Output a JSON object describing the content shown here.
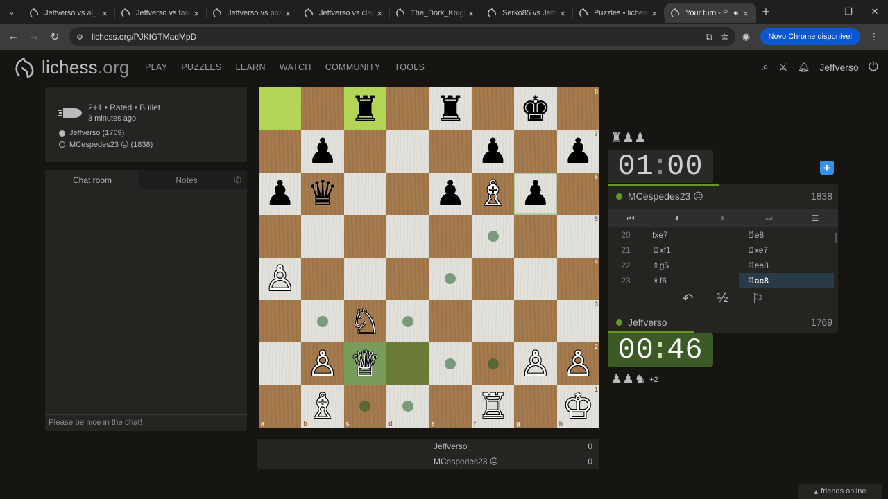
{
  "browser": {
    "tabs": [
      {
        "title": "Jeffverso vs al_a",
        "active": false
      },
      {
        "title": "Jeffverso vs tare",
        "active": false
      },
      {
        "title": "Jeffverso vs posm",
        "active": false
      },
      {
        "title": "Jeffverso vs clag",
        "active": false
      },
      {
        "title": "The_Dork_Knight",
        "active": false
      },
      {
        "title": "Serko85 vs Jeffve",
        "active": false
      },
      {
        "title": "Puzzles • lichess",
        "active": false
      },
      {
        "title": "Your turn - P",
        "active": true
      }
    ],
    "url": "lichess.org/PJKfGTMadMpD",
    "update_chip": "Novo Chrome disponível"
  },
  "site": {
    "logo_main": "lichess",
    "logo_tld": ".org",
    "nav": [
      "PLAY",
      "PUZZLES",
      "LEARN",
      "WATCH",
      "COMMUNITY",
      "TOOLS"
    ],
    "username": "Jeffverso"
  },
  "game_info": {
    "type": "2+1 • Rated • Bullet",
    "time": "3 minutes ago",
    "white": "Jeffverso (1769)",
    "black": "MCespedes23 😐 (1838)"
  },
  "chat": {
    "tab_chat": "Chat room",
    "tab_notes": "Notes",
    "placeholder": "Please be nice in the chat!"
  },
  "board": {
    "ranks": [
      [
        {
          "p": "",
          "c": ""
        },
        {
          "p": "",
          "c": ""
        },
        {
          "p": "♜",
          "c": "b"
        },
        {
          "p": "",
          "c": ""
        },
        {
          "p": "♜",
          "c": "b"
        },
        {
          "p": "",
          "c": ""
        },
        {
          "p": "♚",
          "c": "b"
        },
        {
          "p": "",
          "c": ""
        }
      ],
      [
        {
          "p": "",
          "c": ""
        },
        {
          "p": "♟",
          "c": "b"
        },
        {
          "p": "",
          "c": ""
        },
        {
          "p": "",
          "c": ""
        },
        {
          "p": "",
          "c": ""
        },
        {
          "p": "♟",
          "c": "b"
        },
        {
          "p": "",
          "c": ""
        },
        {
          "p": "♟",
          "c": "b"
        }
      ],
      [
        {
          "p": "♟",
          "c": "b"
        },
        {
          "p": "♛",
          "c": "b"
        },
        {
          "p": "",
          "c": ""
        },
        {
          "p": "",
          "c": ""
        },
        {
          "p": "♟",
          "c": "b"
        },
        {
          "p": "♗",
          "c": "w"
        },
        {
          "p": "♟",
          "c": "b"
        },
        {
          "p": "",
          "c": ""
        }
      ],
      [
        {
          "p": "",
          "c": ""
        },
        {
          "p": "",
          "c": ""
        },
        {
          "p": "",
          "c": ""
        },
        {
          "p": "",
          "c": ""
        },
        {
          "p": "",
          "c": ""
        },
        {
          "p": "",
          "c": ""
        },
        {
          "p": "",
          "c": ""
        },
        {
          "p": "",
          "c": ""
        }
      ],
      [
        {
          "p": "♙",
          "c": "w"
        },
        {
          "p": "",
          "c": ""
        },
        {
          "p": "",
          "c": ""
        },
        {
          "p": "",
          "c": ""
        },
        {
          "p": "",
          "c": ""
        },
        {
          "p": "",
          "c": ""
        },
        {
          "p": "",
          "c": ""
        },
        {
          "p": "",
          "c": ""
        }
      ],
      [
        {
          "p": "",
          "c": ""
        },
        {
          "p": "",
          "c": ""
        },
        {
          "p": "♘",
          "c": "w"
        },
        {
          "p": "",
          "c": ""
        },
        {
          "p": "",
          "c": ""
        },
        {
          "p": "",
          "c": ""
        },
        {
          "p": "",
          "c": ""
        },
        {
          "p": "",
          "c": ""
        }
      ],
      [
        {
          "p": "",
          "c": ""
        },
        {
          "p": "♙",
          "c": "w"
        },
        {
          "p": "♕",
          "c": "w"
        },
        {
          "p": "",
          "c": ""
        },
        {
          "p": "",
          "c": ""
        },
        {
          "p": "",
          "c": ""
        },
        {
          "p": "♙",
          "c": "w"
        },
        {
          "p": "♙",
          "c": "w"
        }
      ],
      [
        {
          "p": "",
          "c": ""
        },
        {
          "p": "♗",
          "c": "w"
        },
        {
          "p": "",
          "c": ""
        },
        {
          "p": "",
          "c": ""
        },
        {
          "p": "",
          "c": ""
        },
        {
          "p": "♖",
          "c": "w"
        },
        {
          "p": "",
          "c": ""
        },
        {
          "p": "♔",
          "c": "w"
        }
      ]
    ],
    "last_move": [
      "a8",
      "c8"
    ],
    "selected": "c2",
    "hover": "d2",
    "move_dots": [
      "f5",
      "e4",
      "b3",
      "d3",
      "e2",
      "f2",
      "c1",
      "d1"
    ],
    "rank_labels": [
      "8",
      "7",
      "6",
      "5",
      "4",
      "3",
      "2",
      "1"
    ],
    "file_labels": [
      "a",
      "b",
      "c",
      "d",
      "e",
      "f",
      "g",
      "h"
    ]
  },
  "top_player": {
    "name": "MCespedes23 😐",
    "rating": "1838",
    "clock_min": "01",
    "clock_sec": "00",
    "material": "♜♟♟"
  },
  "bottom_player": {
    "name": "Jeffverso",
    "rating": "1769",
    "clock_min": "00",
    "clock_sec": "46",
    "material": "♟♟♞",
    "material_plus": "+2"
  },
  "moves": [
    {
      "n": "20",
      "w": "fxe7",
      "b": "♖e8"
    },
    {
      "n": "21",
      "w": "♖xf1",
      "b": "♖xe7"
    },
    {
      "n": "22",
      "w": "♗g5",
      "b": "♖ee8"
    },
    {
      "n": "23",
      "w": "♗f6",
      "b": "♖ac8"
    }
  ],
  "score": [
    {
      "name": "Jeffverso",
      "pts": "0"
    },
    {
      "name": "MCespedes23 😐",
      "pts": "0"
    }
  ],
  "draw_label": "½",
  "friends_label": "friends online"
}
